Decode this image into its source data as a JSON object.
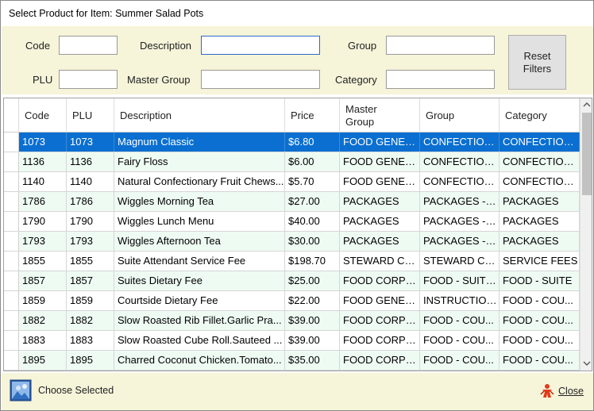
{
  "window": {
    "title": "Select Product for Item: Summer Salad Pots"
  },
  "filters": {
    "code": {
      "label": "Code",
      "value": ""
    },
    "description": {
      "label": "Description",
      "value": ""
    },
    "group": {
      "label": "Group",
      "value": ""
    },
    "plu": {
      "label": "PLU",
      "value": ""
    },
    "master_group": {
      "label": "Master Group",
      "value": ""
    },
    "category": {
      "label": "Category",
      "value": ""
    },
    "reset_label_line1": "Reset",
    "reset_label_line2": "Filters"
  },
  "grid": {
    "columns": {
      "code": "Code",
      "plu": "PLU",
      "description": "Description",
      "price": "Price",
      "master_group_line1": "Master",
      "master_group_line2": "Group",
      "group": "Group",
      "category": "Category"
    },
    "selected_row": 0,
    "rows": [
      {
        "code": "1073",
        "plu": "1073",
        "description": "Magnum Classic",
        "price": "$6.80",
        "master_group": "FOOD GENER...",
        "group": "CONFECTION...",
        "category": "CONFECTION..."
      },
      {
        "code": "1136",
        "plu": "1136",
        "description": "Fairy Floss",
        "price": "$6.00",
        "master_group": "FOOD GENER...",
        "group": "CONFECTION...",
        "category": "CONFECTION..."
      },
      {
        "code": "1140",
        "plu": "1140",
        "description": "Natural Confectionary Fruit Chews...",
        "price": "$5.70",
        "master_group": "FOOD GENER...",
        "group": "CONFECTION...",
        "category": "CONFECTION..."
      },
      {
        "code": "1786",
        "plu": "1786",
        "description": "Wiggles Morning Tea",
        "price": "$27.00",
        "master_group": "PACKAGES",
        "group": "PACKAGES - S...",
        "category": "PACKAGES"
      },
      {
        "code": "1790",
        "plu": "1790",
        "description": "Wiggles Lunch Menu",
        "price": "$40.00",
        "master_group": "PACKAGES",
        "group": "PACKAGES - S...",
        "category": "PACKAGES"
      },
      {
        "code": "1793",
        "plu": "1793",
        "description": "Wiggles Afternoon Tea",
        "price": "$30.00",
        "master_group": "PACKAGES",
        "group": "PACKAGES - S...",
        "category": "PACKAGES"
      },
      {
        "code": "1855",
        "plu": "1855",
        "description": "Suite Attendant Service Fee",
        "price": "$198.70",
        "master_group": "STEWARD CH...",
        "group": "STEWARD CH...",
        "category": "SERVICE FEES"
      },
      {
        "code": "1857",
        "plu": "1857",
        "description": "Suites Dietary Fee",
        "price": "$25.00",
        "master_group": "FOOD CORPO...",
        "group": "FOOD - SUITE...",
        "category": "FOOD - SUITE"
      },
      {
        "code": "1859",
        "plu": "1859",
        "description": "Courtside Dietary Fee",
        "price": "$22.00",
        "master_group": "FOOD GENER...",
        "group": "INSTRUCTION...",
        "category": "FOOD - COU..."
      },
      {
        "code": "1882",
        "plu": "1882",
        "description": "Slow Roasted Rib Fillet.Garlic Pra...",
        "price": "$39.00",
        "master_group": "FOOD CORPO...",
        "group": "FOOD - COU...",
        "category": "FOOD - COU..."
      },
      {
        "code": "1883",
        "plu": "1883",
        "description": "Slow Roasted Cube Roll.Sauteed ...",
        "price": "$39.00",
        "master_group": "FOOD CORPO...",
        "group": "FOOD - COU...",
        "category": "FOOD - COU..."
      },
      {
        "code": "1895",
        "plu": "1895",
        "description": "Charred Coconut Chicken.Tomato...",
        "price": "$35.00",
        "master_group": "FOOD CORPO...",
        "group": "FOOD - COU...",
        "category": "FOOD - COU..."
      }
    ]
  },
  "footer": {
    "choose_label": "Choose Selected",
    "close_label": "Close"
  },
  "icons": {
    "choose": "picture-icon",
    "close": "person-close-icon",
    "scroll_up": "chevron-up-icon",
    "scroll_down": "chevron-down-icon"
  },
  "colors": {
    "selection": "#0a6fd0",
    "alt_row": "#eefbf3",
    "panel": "#f6f4d9",
    "focus_border": "#2b6cc4"
  }
}
